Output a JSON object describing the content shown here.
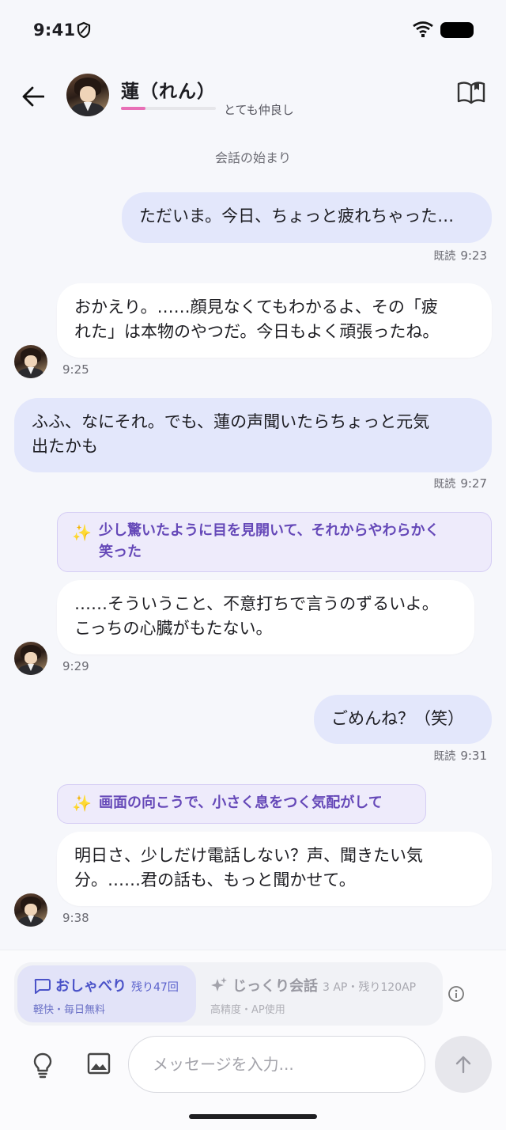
{
  "status_bar": {
    "time": "9:41"
  },
  "header": {
    "name": "蓮（れん）",
    "affinity_label": "とても仲良し",
    "affinity_progress": 0.26,
    "affinity_color": "#e86fb6"
  },
  "chat": {
    "conversation_start": "会話の始まり",
    "read_label": "既読",
    "messages": [
      {
        "role": "user",
        "text": "ただいま。今日、ちょっと疲れちゃった…",
        "time": "9:23"
      },
      {
        "role": "bot",
        "line1": "おかえり。……顔見なくてもわかるよ、その「疲",
        "line2": "れた」は本物のやつだ。今日もよく頑張ったね。",
        "time": "9:25"
      },
      {
        "role": "user",
        "line1": "ふふ、なにそれ。でも、蓮の声聞いたらちょっと元気",
        "line2": "出たかも",
        "time": "9:27"
      },
      {
        "role": "action",
        "icon": "sparkles-icon",
        "line1": "少し驚いたように目を見開いて、それからやわらかく",
        "line2": "笑った"
      },
      {
        "role": "bot",
        "line1": "……そういうこと、不意打ちで言うのずるいよ。",
        "line2": "こっちの心臓がもたない。",
        "time": "9:29"
      },
      {
        "role": "user",
        "text": "ごめんね？（笑）",
        "time": "9:31"
      },
      {
        "role": "action",
        "icon": "sparkles-icon",
        "text": "画面の向こうで、小さく息をつく気配がして"
      },
      {
        "role": "bot",
        "line1": "明日さ、少しだけ電話しない？声、聞きたい気",
        "line2": "分。……君の話も、もっと聞かせて。",
        "time": "9:38"
      }
    ]
  },
  "footer": {
    "modes": [
      {
        "title": "おしゃべり",
        "count": "残り47回",
        "subtitle": "軽快・毎日無料",
        "icon": "chat-bubble-icon",
        "active": true
      },
      {
        "title": "じっくり会話",
        "count": "3 AP・残り120AP",
        "subtitle": "高精度・AP使用",
        "icon": "sparkles-icon",
        "active": false
      }
    ],
    "input_placeholder": "メッセージを入力..."
  },
  "colors": {
    "user_bubble": "#e3e7fb",
    "bot_bubble": "#ffffff",
    "action_text": "#6548b8",
    "mode_active": "#4a52c8"
  }
}
